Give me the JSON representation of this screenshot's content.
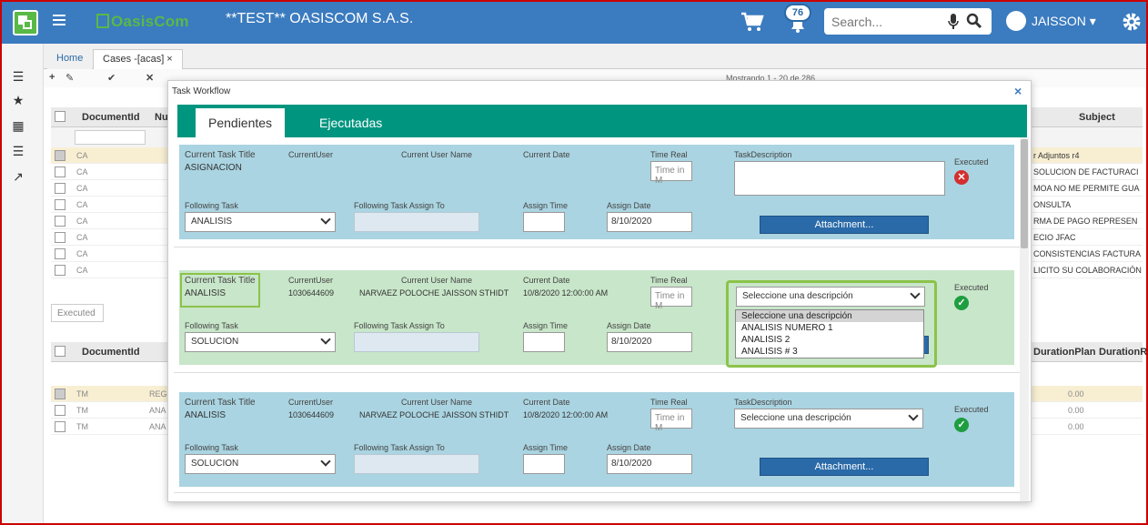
{
  "topbar": {
    "company": "**TEST** OASISCOM S.A.S.",
    "logo_text": "OasisCom",
    "notifications_count": "76",
    "search_placeholder": "Search...",
    "user_name": "JAISSON ▾",
    "accent": "#3b7bbf",
    "brand_green": "#58b947"
  },
  "page_tabs": [
    {
      "label": "Home"
    },
    {
      "label": "Cases -[acas] ×"
    }
  ],
  "toolbar": {
    "paging_text": "Mostrando 1 - 20 de 286"
  },
  "background_grid": {
    "header_col1": "DocumentId",
    "header_col2": "Nu",
    "header_subject": "Subject",
    "rows": [
      {
        "type": "CA",
        "subject": "r Adjuntos r4"
      },
      {
        "type": "CA",
        "subject": "SOLUCION DE FACTURACI"
      },
      {
        "type": "CA",
        "subject": "MOA NO ME PERMITE GUA"
      },
      {
        "type": "CA",
        "subject": "ONSULTA"
      },
      {
        "type": "CA",
        "subject": "RMA DE PAGO REPRESEN"
      },
      {
        "type": "CA",
        "subject": "ECIO JFAC"
      },
      {
        "type": "CA",
        "subject": "CONSISTENCIAS FACTURA"
      },
      {
        "type": "CA",
        "subject": "LICITO SU COLABORACIÓN"
      }
    ]
  },
  "executed_grid": {
    "tab_label": "Executed",
    "header_col1": "DocumentId",
    "header_duration_plan": "DurationPlan",
    "header_duration_real": "DurationRe",
    "rows": [
      {
        "type": "TM",
        "code": "REG",
        "plan": "0.00"
      },
      {
        "type": "TM",
        "code": "ANA",
        "plan": "0.00"
      },
      {
        "type": "TM",
        "code": "ANA",
        "plan": "0.00"
      }
    ]
  },
  "modal": {
    "title": "Task Workflow",
    "close": "×",
    "tabs": [
      {
        "label": "Pendientes"
      },
      {
        "label": "Ejecutadas"
      }
    ],
    "labels": {
      "current_task_title": "Current Task Title",
      "current_user": "CurrentUser",
      "current_user_name": "Current User Name",
      "current_date": "Current Date",
      "time_real": "Time Real",
      "task_description": "TaskDescription",
      "executed": "Executed",
      "following_task": "Following Task",
      "following_task_assign_to": "Following Task Assign To",
      "assign_time": "Assign Time",
      "assign_date": "Assign Date",
      "attachment": "Attachment...",
      "time_placeholder": "Time in M"
    },
    "tasks": [
      {
        "title": "ASIGNACION",
        "user": "",
        "user_name": "",
        "date": "",
        "following": "ANALISIS",
        "assign_date": "8/10/2020",
        "executed": false
      },
      {
        "title": "ANALISIS",
        "user": "1030644609",
        "user_name": "NARVAEZ POLOCHE JAISSON STHIDT",
        "date": "10/8/2020 12:00:00 AM",
        "following": "SOLUCION",
        "assign_date": "8/10/2020",
        "description_select": "Seleccione una descripción",
        "executed": true
      },
      {
        "title": "ANALISIS",
        "user": "1030644609",
        "user_name": "NARVAEZ POLOCHE JAISSON STHIDT",
        "date": "10/8/2020 12:00:00 AM",
        "following": "SOLUCION",
        "assign_date": "8/10/2020",
        "description_select": "Seleccione una descripción",
        "executed": true
      }
    ],
    "dropdown_options": [
      "Seleccione una descripción",
      "ANALISIS NUMERO 1",
      "ANALISIS 2",
      "ANALISIS # 3"
    ]
  }
}
